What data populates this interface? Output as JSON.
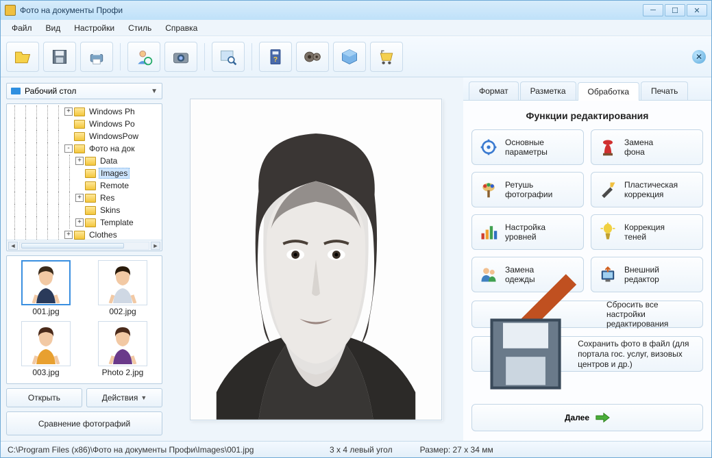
{
  "window": {
    "title": "Фото на документы Профи"
  },
  "menu": {
    "file": "Файл",
    "view": "Вид",
    "settings": "Настройки",
    "style": "Стиль",
    "help": "Справка"
  },
  "sidebar": {
    "root_label": "Рабочий стол",
    "tree": [
      {
        "label": "Windows Ph",
        "expand": "+"
      },
      {
        "label": "Windows Po",
        "expand": ""
      },
      {
        "label": "WindowsPow",
        "expand": ""
      },
      {
        "label": "Фото на док",
        "expand": "-"
      },
      {
        "label": "Data",
        "expand": "+",
        "child": true
      },
      {
        "label": "Images",
        "expand": "",
        "child": true,
        "selected": true
      },
      {
        "label": "Remote",
        "expand": "",
        "child": true
      },
      {
        "label": "Res",
        "expand": "+",
        "child": true
      },
      {
        "label": "Skins",
        "expand": "",
        "child": true
      },
      {
        "label": "Template",
        "expand": "+",
        "child": true
      },
      {
        "label": "Clothes",
        "expand": "+"
      }
    ],
    "thumbs": [
      "001.jpg",
      "002.jpg",
      "003.jpg",
      "Photo 2.jpg"
    ],
    "open": "Открыть",
    "actions": "Действия",
    "compare": "Сравнение фотографий"
  },
  "tabs": {
    "format": "Формат",
    "layout": "Разметка",
    "process": "Обработка",
    "print": "Печать"
  },
  "edit": {
    "title": "Функции редактирования",
    "items": [
      {
        "line1": "Основные",
        "line2": "параметры"
      },
      {
        "line1": "Замена",
        "line2": "фона"
      },
      {
        "line1": "Ретушь",
        "line2": "фотографии"
      },
      {
        "line1": "Пластическая",
        "line2": "коррекция"
      },
      {
        "line1": "Настройка",
        "line2": "уровней"
      },
      {
        "line1": "Коррекция",
        "line2": "теней"
      },
      {
        "line1": "Замена",
        "line2": "одежды"
      },
      {
        "line1": "Внешний",
        "line2": "редактор"
      }
    ],
    "reset": "Сбросить все настройки редактирования",
    "save": "Сохранить фото в файл (для портала гос. услуг, визовых центров и др.)",
    "next": "Далее"
  },
  "status": {
    "path": "C:\\Program Files (x86)\\Фото на документы Профи\\Images\\001.jpg",
    "corner": "3 x 4 левый угол",
    "size": "Размер: 27 x 34 мм"
  }
}
